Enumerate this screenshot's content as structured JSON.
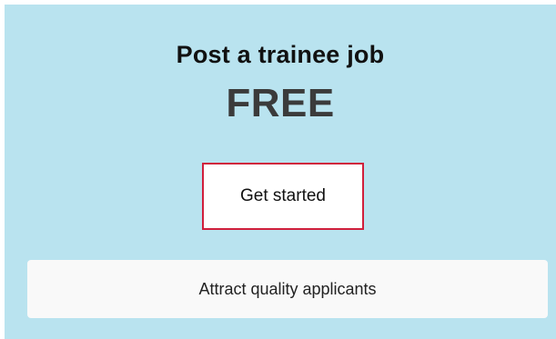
{
  "promo": {
    "title": "Post a trainee job",
    "price_text": "FREE",
    "cta_label": "Get started",
    "banner_text": "Attract quality applicants"
  },
  "colors": {
    "panel_background": "#b9e3ef",
    "cta_border": "#d01f3c",
    "banner_background": "#f9f9f9"
  }
}
